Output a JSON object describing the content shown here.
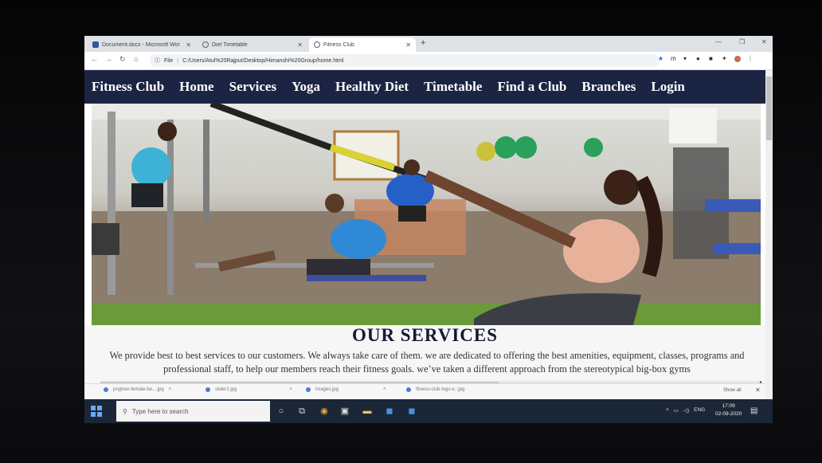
{
  "browser": {
    "tabs": [
      {
        "label": "Document.docx - Microsoft Wor",
        "icon": "word-icon",
        "color": "#2b579a"
      },
      {
        "label": "Diet Timetable",
        "icon": "globe-icon",
        "color": "#5f6368"
      },
      {
        "label": "Fitness Club",
        "icon": "globe-icon",
        "color": "#5f6368"
      }
    ],
    "new_tab": "+",
    "address": {
      "scheme": "File",
      "path": "C:/Users/Atul%20Rajput/Desktop/Himanshi%20Group/home.html"
    }
  },
  "site": {
    "nav": [
      "Fitness Club",
      "Home",
      "Services",
      "Yoga",
      "Healthy Diet",
      "Timetable",
      "Find a Club",
      "Branches",
      "Login"
    ],
    "nav_bg": "#1c2444",
    "services": {
      "heading": "OUR SERVICES",
      "text": "We provide best to best services to our customers. We always take care of them. we are dedicated to offering the best amenities, equipment, classes, programs and professional staff, to help our members reach their fitness goals. we’ve taken a different approach from the stereotypical big-box gyms"
    }
  },
  "downloads": {
    "items": [
      "pngtree-female-be....jpg",
      "slider1.jpg",
      "images.jpg",
      "fitness-club-logo-v...jpg"
    ],
    "show_all": "Show all"
  },
  "taskbar": {
    "search_placeholder": "Type here to search",
    "tray": {
      "lang": "ENG",
      "time": "17:09",
      "date": "02-09-2020"
    }
  }
}
